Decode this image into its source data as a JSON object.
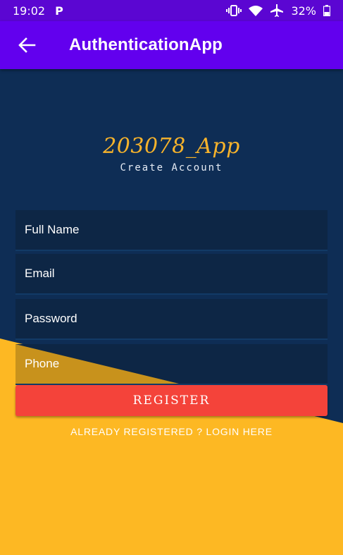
{
  "status_bar": {
    "time": "19:02",
    "notification": "P",
    "battery": "32%",
    "icons": [
      "vibrate-icon",
      "wifi-icon",
      "airplane-icon",
      "battery-icon"
    ]
  },
  "app_bar": {
    "title": "AuthenticationApp",
    "back_icon": "arrow-back-icon",
    "background": "#6200ee"
  },
  "brand": {
    "name": "203078_App",
    "subtitle": "Create Account",
    "color": "#f7b32b"
  },
  "form": {
    "fields": [
      {
        "hint": "Full Name"
      },
      {
        "hint": "Email"
      },
      {
        "hint": "Password"
      },
      {
        "hint": "Phone"
      }
    ],
    "register_label": "REGISTER",
    "login_link": "ALREADY REGISTERED ? LOGIN HERE"
  },
  "colors": {
    "background": "#0e2d55",
    "accent_yellow": "#fdb823",
    "button": "#f4433a"
  }
}
